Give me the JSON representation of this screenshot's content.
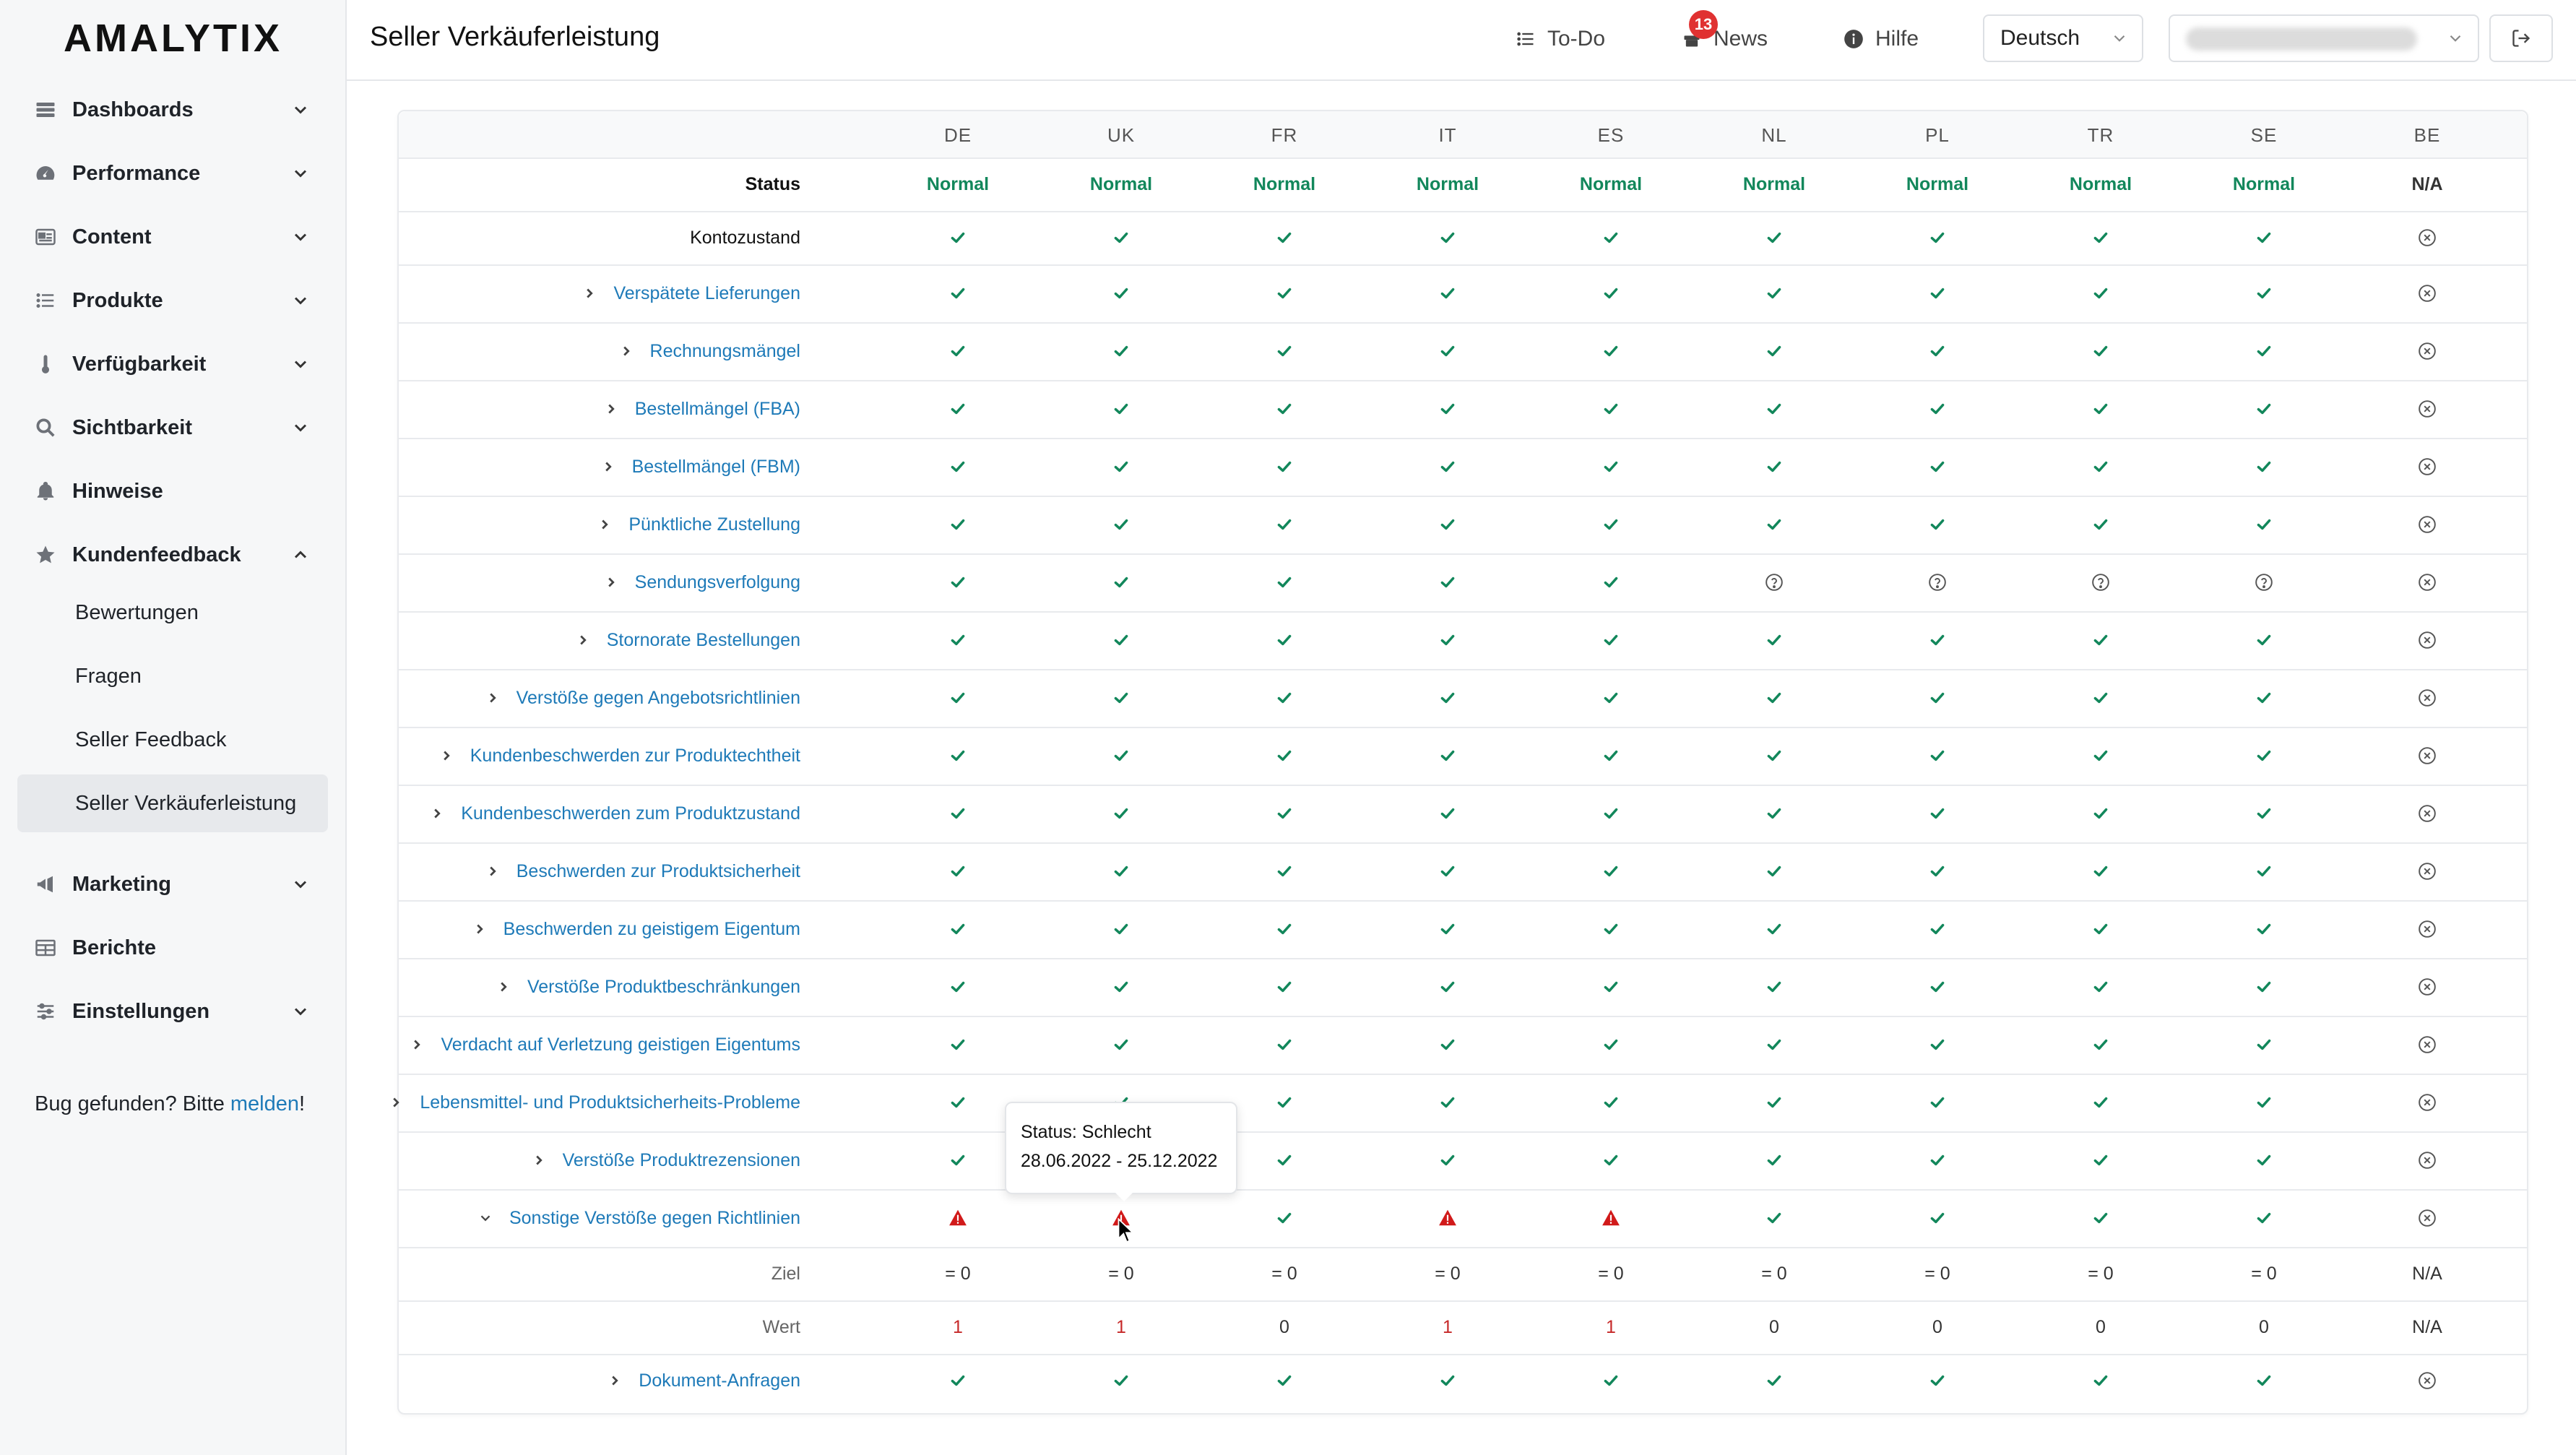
{
  "sidebar": {
    "logo": "AMALYTIX",
    "items": [
      {
        "label": "Dashboards",
        "icon": "dashboard-icon"
      },
      {
        "label": "Performance",
        "icon": "gauge-icon"
      },
      {
        "label": "Content",
        "icon": "content-icon"
      },
      {
        "label": "Produkte",
        "icon": "list-icon"
      },
      {
        "label": "Verfügbarkeit",
        "icon": "thermometer-icon"
      },
      {
        "label": "Sichtbarkeit",
        "icon": "search-icon"
      },
      {
        "label": "Hinweise",
        "icon": "bell-icon"
      },
      {
        "label": "Kundenfeedback",
        "icon": "star-icon"
      }
    ],
    "sub_items": [
      "Bewertungen",
      "Fragen",
      "Seller Feedback",
      "Seller Verkäuferleistung"
    ],
    "items_after": [
      {
        "label": "Marketing",
        "icon": "megaphone-icon"
      },
      {
        "label": "Berichte",
        "icon": "table-icon"
      },
      {
        "label": "Einstellungen",
        "icon": "sliders-icon"
      }
    ],
    "bug_text": "Bug gefunden? Bitte ",
    "bug_link": "melden",
    "bug_end": "!"
  },
  "header": {
    "title": "Seller Verkäuferleistung",
    "todo": "To-Do",
    "news": "News",
    "news_badge": "13",
    "help": "Hilfe",
    "language": "Deutsch"
  },
  "table": {
    "columns": [
      "DE",
      "UK",
      "FR",
      "IT",
      "ES",
      "NL",
      "PL",
      "TR",
      "SE",
      "BE"
    ],
    "rows": [
      {
        "label": "Status",
        "style": "bold",
        "cells": [
          "Normal",
          "Normal",
          "Normal",
          "Normal",
          "Normal",
          "Normal",
          "Normal",
          "Normal",
          "Normal",
          "N/A"
        ]
      },
      {
        "label": "Kontozustand",
        "style": "plain",
        "cells": [
          "ok",
          "ok",
          "ok",
          "ok",
          "ok",
          "ok",
          "ok",
          "ok",
          "ok",
          "x"
        ]
      },
      {
        "label": "Verspätete Lieferungen",
        "style": "link",
        "expand": "right",
        "cells": [
          "ok",
          "ok",
          "ok",
          "ok",
          "ok",
          "ok",
          "ok",
          "ok",
          "ok",
          "x"
        ]
      },
      {
        "label": "Rechnungsmängel",
        "style": "link",
        "expand": "right",
        "cells": [
          "ok",
          "ok",
          "ok",
          "ok",
          "ok",
          "ok",
          "ok",
          "ok",
          "ok",
          "x"
        ]
      },
      {
        "label": "Bestellmängel (FBA)",
        "style": "link",
        "expand": "right",
        "cells": [
          "ok",
          "ok",
          "ok",
          "ok",
          "ok",
          "ok",
          "ok",
          "ok",
          "ok",
          "x"
        ]
      },
      {
        "label": "Bestellmängel (FBM)",
        "style": "link",
        "expand": "right",
        "cells": [
          "ok",
          "ok",
          "ok",
          "ok",
          "ok",
          "ok",
          "ok",
          "ok",
          "ok",
          "x"
        ]
      },
      {
        "label": "Pünktliche Zustellung",
        "style": "link",
        "expand": "right",
        "cells": [
          "ok",
          "ok",
          "ok",
          "ok",
          "ok",
          "ok",
          "ok",
          "ok",
          "ok",
          "x"
        ]
      },
      {
        "label": "Sendungsverfolgung",
        "style": "link",
        "expand": "right",
        "cells": [
          "ok",
          "ok",
          "ok",
          "ok",
          "ok",
          "q",
          "q",
          "q",
          "q",
          "x"
        ]
      },
      {
        "label": "Stornorate Bestellungen",
        "style": "link",
        "expand": "right",
        "cells": [
          "ok",
          "ok",
          "ok",
          "ok",
          "ok",
          "ok",
          "ok",
          "ok",
          "ok",
          "x"
        ]
      },
      {
        "label": "Verstöße gegen Angebotsrichtlinien",
        "style": "link",
        "expand": "right",
        "cells": [
          "ok",
          "ok",
          "ok",
          "ok",
          "ok",
          "ok",
          "ok",
          "ok",
          "ok",
          "x"
        ]
      },
      {
        "label": "Kundenbeschwerden zur Produktechtheit",
        "style": "link",
        "expand": "right",
        "cells": [
          "ok",
          "ok",
          "ok",
          "ok",
          "ok",
          "ok",
          "ok",
          "ok",
          "ok",
          "x"
        ]
      },
      {
        "label": "Kundenbeschwerden zum Produktzustand",
        "style": "link",
        "expand": "right",
        "cells": [
          "ok",
          "ok",
          "ok",
          "ok",
          "ok",
          "ok",
          "ok",
          "ok",
          "ok",
          "x"
        ]
      },
      {
        "label": "Beschwerden zur Produktsicherheit",
        "style": "link",
        "expand": "right",
        "cells": [
          "ok",
          "ok",
          "ok",
          "ok",
          "ok",
          "ok",
          "ok",
          "ok",
          "ok",
          "x"
        ]
      },
      {
        "label": "Beschwerden zu geistigem Eigentum",
        "style": "link",
        "expand": "right",
        "cells": [
          "ok",
          "ok",
          "ok",
          "ok",
          "ok",
          "ok",
          "ok",
          "ok",
          "ok",
          "x"
        ]
      },
      {
        "label": "Verstöße Produktbeschränkungen",
        "style": "link",
        "expand": "right",
        "cells": [
          "ok",
          "ok",
          "ok",
          "ok",
          "ok",
          "ok",
          "ok",
          "ok",
          "ok",
          "x"
        ]
      },
      {
        "label": "Verdacht auf Verletzung geistigen Eigentums",
        "style": "link",
        "expand": "right",
        "cells": [
          "ok",
          "ok",
          "ok",
          "ok",
          "ok",
          "ok",
          "ok",
          "ok",
          "ok",
          "x"
        ]
      },
      {
        "label": "Lebensmittel- und Produktsicherheits-Probleme",
        "style": "link",
        "expand": "right",
        "cells": [
          "ok",
          "ok",
          "ok",
          "ok",
          "ok",
          "ok",
          "ok",
          "ok",
          "ok",
          "x"
        ]
      },
      {
        "label": "Verstöße Produktrezensionen",
        "style": "link",
        "expand": "right",
        "cells": [
          "ok",
          "ok",
          "ok",
          "ok",
          "ok",
          "ok",
          "ok",
          "ok",
          "ok",
          "x"
        ]
      },
      {
        "label": "Sonstige Verstöße gegen Richtlinien",
        "style": "link",
        "expand": "down",
        "cells": [
          "warn",
          "warn",
          "ok",
          "warn",
          "warn",
          "ok",
          "ok",
          "ok",
          "ok",
          "x"
        ]
      },
      {
        "label": "Ziel",
        "style": "muted",
        "cells": [
          "= 0",
          "= 0",
          "= 0",
          "= 0",
          "= 0",
          "= 0",
          "= 0",
          "= 0",
          "= 0",
          "N/A"
        ]
      },
      {
        "label": "Wert",
        "style": "muted",
        "cells": [
          "1",
          "1",
          "0",
          "1",
          "1",
          "0",
          "0",
          "0",
          "0",
          "N/A"
        ],
        "red": [
          true,
          true,
          false,
          true,
          true,
          false,
          false,
          false,
          false,
          false
        ]
      },
      {
        "label": "Dokument-Anfragen",
        "style": "link",
        "expand": "right",
        "cells": [
          "ok",
          "ok",
          "ok",
          "ok",
          "ok",
          "ok",
          "ok",
          "ok",
          "ok",
          "x"
        ]
      }
    ]
  },
  "tooltip": {
    "line1": "Status: Schlecht",
    "line2": "28.06.2022 - 25.12.2022"
  },
  "colors": {
    "ok_green": "#12875b",
    "warn_red": "#d11a1a",
    "link_blue": "#1e7ab8",
    "badge_red": "#e03131"
  }
}
